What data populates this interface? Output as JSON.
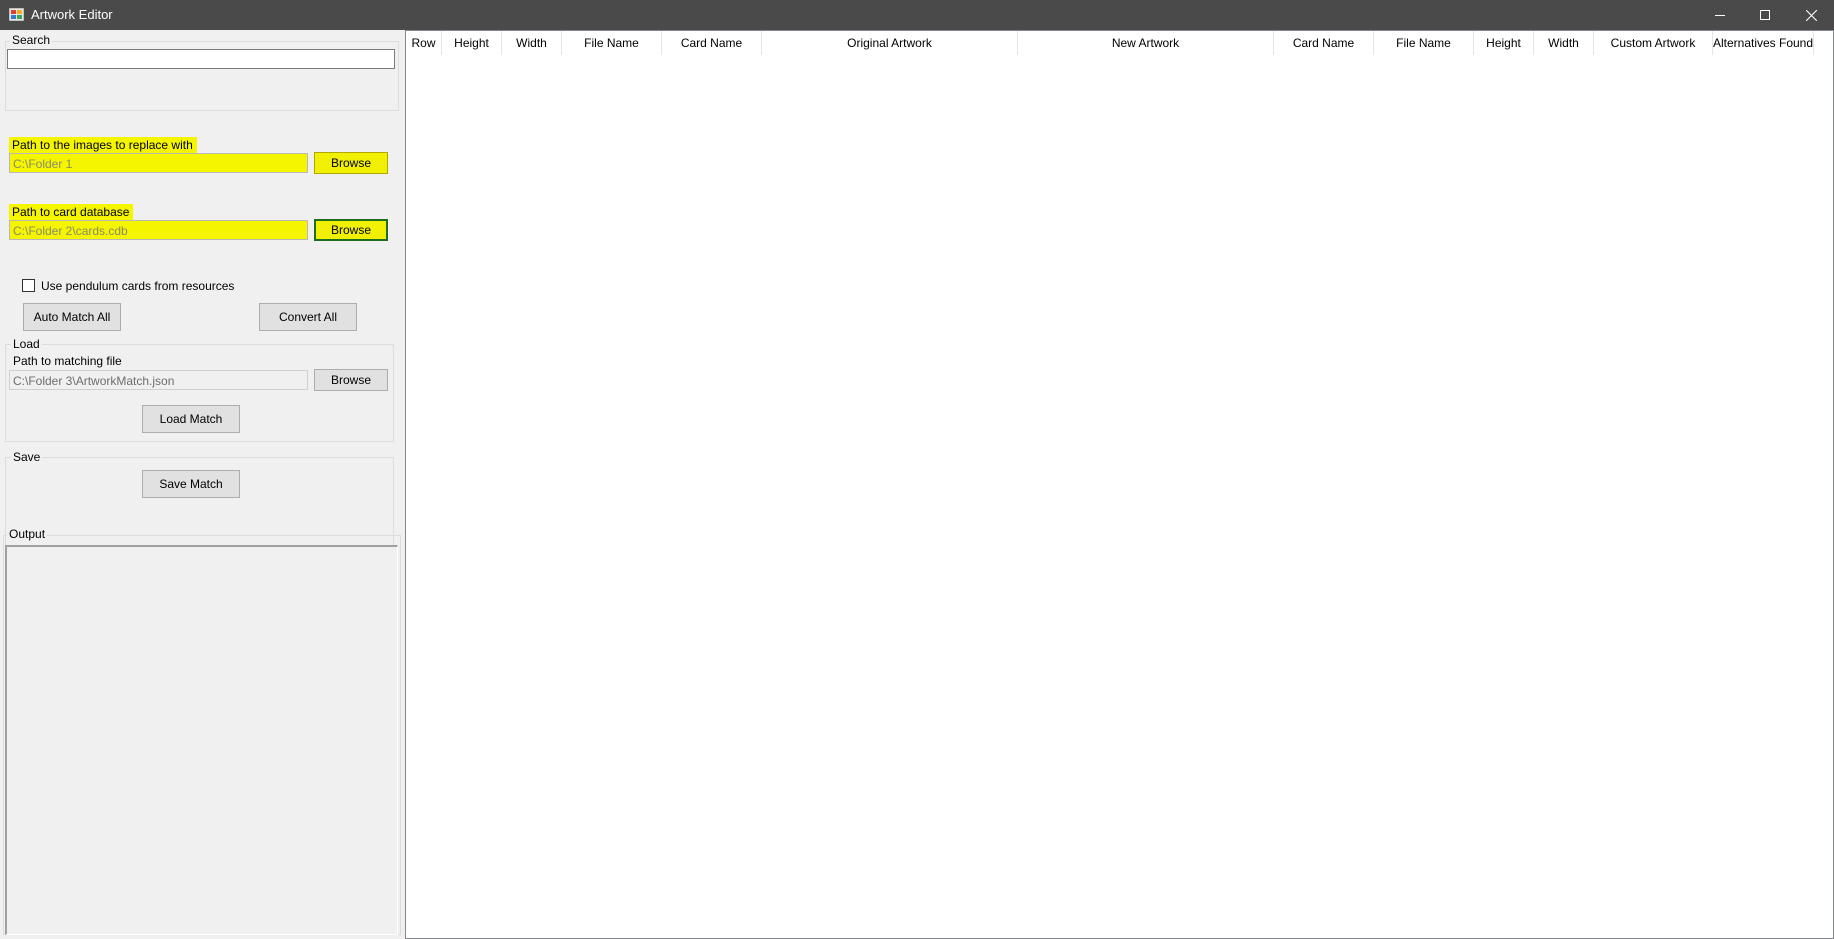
{
  "window": {
    "title": "Artwork Editor"
  },
  "search": {
    "title": "Search",
    "value": ""
  },
  "images_path": {
    "label": "Path to the images to replace with",
    "value": "C:\\Folder 1",
    "browse_label": "Browse"
  },
  "database_path": {
    "label": "Path to card database",
    "value": "C:\\Folder 2\\cards.cdb",
    "browse_label": "Browse"
  },
  "options": {
    "pendulum_label": "Use pendulum cards from resources",
    "pendulum_checked": false
  },
  "actions": {
    "auto_match_label": "Auto Match All",
    "convert_label": "Convert All"
  },
  "load": {
    "title": "Load",
    "path_label": "Path to matching file",
    "value": "C:\\Folder 3\\ArtworkMatch.json",
    "browse_label": "Browse",
    "load_label": "Load Match"
  },
  "save": {
    "title": "Save",
    "save_label": "Save Match"
  },
  "output": {
    "title": "Output",
    "text": ""
  },
  "grid": {
    "columns": [
      "Row",
      "Height",
      "Width",
      "File Name",
      "Card Name",
      "Original Artwork",
      "New Artwork",
      "Card Name",
      "File Name",
      "Height",
      "Width",
      "Custom Artwork",
      "Alternatives Found"
    ]
  },
  "colors": {
    "highlight": "#f5f500",
    "titlebar": "#4a4a4a",
    "focus_border": "#1f6e1f"
  }
}
